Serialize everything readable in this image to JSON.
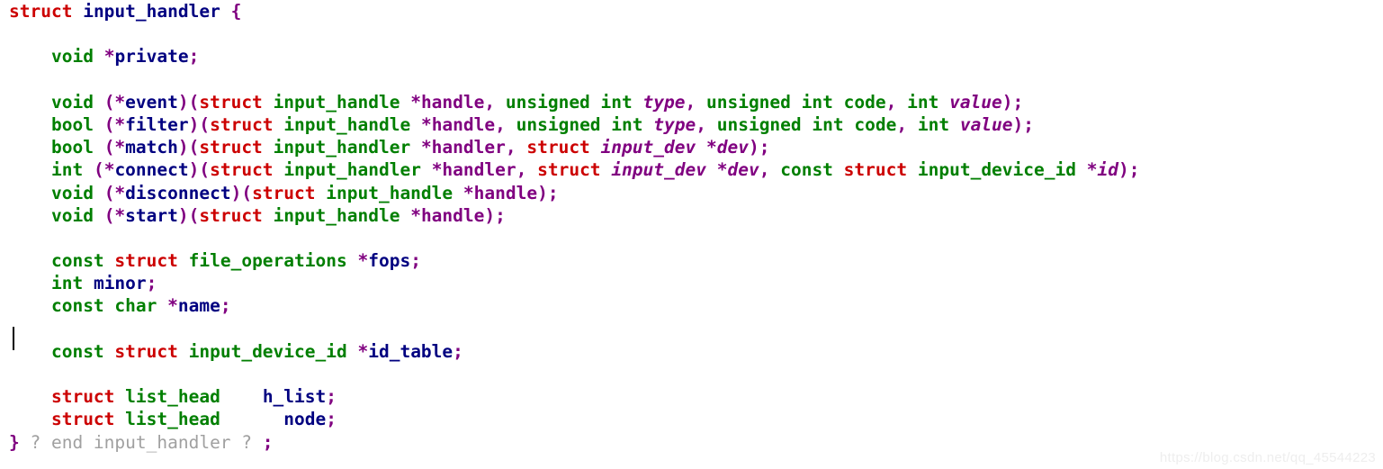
{
  "editor": {
    "language": "c",
    "background_color": "#ffffff",
    "caret_visible": true,
    "watermark": "https://blog.csdn.net/qq_45544223",
    "colors": {
      "keyword_struct": "#cc0000",
      "type": "#007f00",
      "identifier": "#000080",
      "punctuation": "#800080",
      "parameter": "#800080",
      "fold_marker": "#a0a0a0",
      "watermark": "#eeeeee"
    }
  },
  "code": {
    "lines": [
      {
        "index": 0,
        "text": "struct input_handler {",
        "tokens": [
          {
            "t": "struct",
            "c": "keyword"
          },
          {
            "t": " ",
            "c": "plain"
          },
          {
            "t": "input_handler",
            "c": "ident"
          },
          {
            "t": " ",
            "c": "plain"
          },
          {
            "t": "{",
            "c": "punct"
          }
        ]
      },
      {
        "index": 1,
        "text": "",
        "tokens": []
      },
      {
        "index": 2,
        "text": "    void *private;",
        "tokens": [
          {
            "t": "    ",
            "c": "plain"
          },
          {
            "t": "void",
            "c": "type"
          },
          {
            "t": " ",
            "c": "plain"
          },
          {
            "t": "*",
            "c": "punct"
          },
          {
            "t": "private",
            "c": "ident"
          },
          {
            "t": ";",
            "c": "punct"
          }
        ]
      },
      {
        "index": 3,
        "text": "",
        "tokens": []
      },
      {
        "index": 4,
        "text": "    void (*event)(struct input_handle *handle, unsigned int type, unsigned int code, int value);",
        "tokens": [
          {
            "t": "    ",
            "c": "plain"
          },
          {
            "t": "void",
            "c": "type"
          },
          {
            "t": " ",
            "c": "plain"
          },
          {
            "t": "(*",
            "c": "punct"
          },
          {
            "t": "event",
            "c": "ident"
          },
          {
            "t": ")(",
            "c": "punct"
          },
          {
            "t": "struct",
            "c": "keyword"
          },
          {
            "t": " ",
            "c": "plain"
          },
          {
            "t": "input_handle",
            "c": "type"
          },
          {
            "t": " ",
            "c": "plain"
          },
          {
            "t": "*handle,",
            "c": "punct"
          },
          {
            "t": " ",
            "c": "plain"
          },
          {
            "t": "unsigned int",
            "c": "type"
          },
          {
            "t": " ",
            "c": "plain"
          },
          {
            "t": "type",
            "c": "param"
          },
          {
            "t": ",",
            "c": "punct"
          },
          {
            "t": " ",
            "c": "plain"
          },
          {
            "t": "unsigned int",
            "c": "type"
          },
          {
            "t": " ",
            "c": "plain"
          },
          {
            "t": "code",
            "c": "type"
          },
          {
            "t": ",",
            "c": "punct"
          },
          {
            "t": " ",
            "c": "plain"
          },
          {
            "t": "int",
            "c": "type"
          },
          {
            "t": " ",
            "c": "plain"
          },
          {
            "t": "value",
            "c": "param"
          },
          {
            "t": ");",
            "c": "punct"
          }
        ]
      },
      {
        "index": 5,
        "text": "    bool (*filter)(struct input_handle *handle, unsigned int type, unsigned int code, int value);",
        "tokens": [
          {
            "t": "    ",
            "c": "plain"
          },
          {
            "t": "bool",
            "c": "type"
          },
          {
            "t": " ",
            "c": "plain"
          },
          {
            "t": "(*",
            "c": "punct"
          },
          {
            "t": "filter",
            "c": "ident"
          },
          {
            "t": ")(",
            "c": "punct"
          },
          {
            "t": "struct",
            "c": "keyword"
          },
          {
            "t": " ",
            "c": "plain"
          },
          {
            "t": "input_handle",
            "c": "type"
          },
          {
            "t": " ",
            "c": "plain"
          },
          {
            "t": "*handle,",
            "c": "punct"
          },
          {
            "t": " ",
            "c": "plain"
          },
          {
            "t": "unsigned int",
            "c": "type"
          },
          {
            "t": " ",
            "c": "plain"
          },
          {
            "t": "type",
            "c": "param"
          },
          {
            "t": ",",
            "c": "punct"
          },
          {
            "t": " ",
            "c": "plain"
          },
          {
            "t": "unsigned int",
            "c": "type"
          },
          {
            "t": " ",
            "c": "plain"
          },
          {
            "t": "code",
            "c": "type"
          },
          {
            "t": ",",
            "c": "punct"
          },
          {
            "t": " ",
            "c": "plain"
          },
          {
            "t": "int",
            "c": "type"
          },
          {
            "t": " ",
            "c": "plain"
          },
          {
            "t": "value",
            "c": "param"
          },
          {
            "t": ");",
            "c": "punct"
          }
        ]
      },
      {
        "index": 6,
        "text": "    bool (*match)(struct input_handler *handler, struct input_dev *dev);",
        "tokens": [
          {
            "t": "    ",
            "c": "plain"
          },
          {
            "t": "bool",
            "c": "type"
          },
          {
            "t": " ",
            "c": "plain"
          },
          {
            "t": "(*",
            "c": "punct"
          },
          {
            "t": "match",
            "c": "ident"
          },
          {
            "t": ")(",
            "c": "punct"
          },
          {
            "t": "struct",
            "c": "keyword"
          },
          {
            "t": " ",
            "c": "plain"
          },
          {
            "t": "input_handler",
            "c": "type"
          },
          {
            "t": " ",
            "c": "plain"
          },
          {
            "t": "*handler,",
            "c": "punct"
          },
          {
            "t": " ",
            "c": "plain"
          },
          {
            "t": "struct",
            "c": "keyword"
          },
          {
            "t": " ",
            "c": "plain"
          },
          {
            "t": "input_dev",
            "c": "param"
          },
          {
            "t": " ",
            "c": "plain"
          },
          {
            "t": "*",
            "c": "punct"
          },
          {
            "t": "dev",
            "c": "param"
          },
          {
            "t": ");",
            "c": "punct"
          }
        ]
      },
      {
        "index": 7,
        "text": "    int (*connect)(struct input_handler *handler, struct input_dev *dev, const struct input_device_id *id);",
        "tokens": [
          {
            "t": "    ",
            "c": "plain"
          },
          {
            "t": "int",
            "c": "type"
          },
          {
            "t": " ",
            "c": "plain"
          },
          {
            "t": "(*",
            "c": "punct"
          },
          {
            "t": "connect",
            "c": "ident"
          },
          {
            "t": ")(",
            "c": "punct"
          },
          {
            "t": "struct",
            "c": "keyword"
          },
          {
            "t": " ",
            "c": "plain"
          },
          {
            "t": "input_handler",
            "c": "type"
          },
          {
            "t": " ",
            "c": "plain"
          },
          {
            "t": "*handler,",
            "c": "punct"
          },
          {
            "t": " ",
            "c": "plain"
          },
          {
            "t": "struct",
            "c": "keyword"
          },
          {
            "t": " ",
            "c": "plain"
          },
          {
            "t": "input_dev",
            "c": "param"
          },
          {
            "t": " ",
            "c": "plain"
          },
          {
            "t": "*",
            "c": "punct"
          },
          {
            "t": "dev",
            "c": "param"
          },
          {
            "t": ",",
            "c": "punct"
          },
          {
            "t": " ",
            "c": "plain"
          },
          {
            "t": "const",
            "c": "type"
          },
          {
            "t": " ",
            "c": "plain"
          },
          {
            "t": "struct",
            "c": "keyword"
          },
          {
            "t": " ",
            "c": "plain"
          },
          {
            "t": "input_device_id",
            "c": "type"
          },
          {
            "t": " ",
            "c": "plain"
          },
          {
            "t": "*",
            "c": "punct"
          },
          {
            "t": "id",
            "c": "param"
          },
          {
            "t": ");",
            "c": "punct"
          }
        ]
      },
      {
        "index": 8,
        "text": "    void (*disconnect)(struct input_handle *handle);",
        "tokens": [
          {
            "t": "    ",
            "c": "plain"
          },
          {
            "t": "void",
            "c": "type"
          },
          {
            "t": " ",
            "c": "plain"
          },
          {
            "t": "(*",
            "c": "punct"
          },
          {
            "t": "disconnect",
            "c": "ident"
          },
          {
            "t": ")(",
            "c": "punct"
          },
          {
            "t": "struct",
            "c": "keyword"
          },
          {
            "t": " ",
            "c": "plain"
          },
          {
            "t": "input_handle",
            "c": "type"
          },
          {
            "t": " ",
            "c": "plain"
          },
          {
            "t": "*handle",
            "c": "punct"
          },
          {
            "t": ");",
            "c": "punct"
          }
        ]
      },
      {
        "index": 9,
        "text": "    void (*start)(struct input_handle *handle);",
        "tokens": [
          {
            "t": "    ",
            "c": "plain"
          },
          {
            "t": "void",
            "c": "type"
          },
          {
            "t": " ",
            "c": "plain"
          },
          {
            "t": "(*",
            "c": "punct"
          },
          {
            "t": "start",
            "c": "ident"
          },
          {
            "t": ")(",
            "c": "punct"
          },
          {
            "t": "struct",
            "c": "keyword"
          },
          {
            "t": " ",
            "c": "plain"
          },
          {
            "t": "input_handle",
            "c": "type"
          },
          {
            "t": " ",
            "c": "plain"
          },
          {
            "t": "*handle",
            "c": "punct"
          },
          {
            "t": ");",
            "c": "punct"
          }
        ]
      },
      {
        "index": 10,
        "text": "",
        "tokens": []
      },
      {
        "index": 11,
        "text": "    const struct file_operations *fops;",
        "tokens": [
          {
            "t": "    ",
            "c": "plain"
          },
          {
            "t": "const",
            "c": "type"
          },
          {
            "t": " ",
            "c": "plain"
          },
          {
            "t": "struct",
            "c": "keyword"
          },
          {
            "t": " ",
            "c": "plain"
          },
          {
            "t": "file_operations",
            "c": "type"
          },
          {
            "t": " ",
            "c": "plain"
          },
          {
            "t": "*",
            "c": "punct"
          },
          {
            "t": "fops",
            "c": "ident"
          },
          {
            "t": ";",
            "c": "punct"
          }
        ]
      },
      {
        "index": 12,
        "text": "    int minor;",
        "tokens": [
          {
            "t": "    ",
            "c": "plain"
          },
          {
            "t": "int",
            "c": "type"
          },
          {
            "t": " ",
            "c": "plain"
          },
          {
            "t": "minor",
            "c": "ident"
          },
          {
            "t": ";",
            "c": "punct"
          }
        ]
      },
      {
        "index": 13,
        "text": "    const char *name;",
        "tokens": [
          {
            "t": "    ",
            "c": "plain"
          },
          {
            "t": "const",
            "c": "type"
          },
          {
            "t": " ",
            "c": "plain"
          },
          {
            "t": "char",
            "c": "type"
          },
          {
            "t": " ",
            "c": "plain"
          },
          {
            "t": "*",
            "c": "punct"
          },
          {
            "t": "name",
            "c": "ident"
          },
          {
            "t": ";",
            "c": "punct"
          }
        ]
      },
      {
        "index": 14,
        "text": "",
        "tokens": []
      },
      {
        "index": 15,
        "text": "    const struct input_device_id *id_table;",
        "tokens": [
          {
            "t": "    ",
            "c": "plain"
          },
          {
            "t": "const",
            "c": "type"
          },
          {
            "t": " ",
            "c": "plain"
          },
          {
            "t": "struct",
            "c": "keyword"
          },
          {
            "t": " ",
            "c": "plain"
          },
          {
            "t": "input_device_id",
            "c": "type"
          },
          {
            "t": " ",
            "c": "plain"
          },
          {
            "t": "*",
            "c": "punct"
          },
          {
            "t": "id_table",
            "c": "ident"
          },
          {
            "t": ";",
            "c": "punct"
          }
        ]
      },
      {
        "index": 16,
        "text": "",
        "tokens": []
      },
      {
        "index": 17,
        "text": "    struct list_head    h_list;",
        "tokens": [
          {
            "t": "    ",
            "c": "plain"
          },
          {
            "t": "struct",
            "c": "keyword"
          },
          {
            "t": " ",
            "c": "plain"
          },
          {
            "t": "list_head",
            "c": "type"
          },
          {
            "t": "    ",
            "c": "plain"
          },
          {
            "t": "h_list",
            "c": "ident"
          },
          {
            "t": ";",
            "c": "punct"
          }
        ]
      },
      {
        "index": 18,
        "text": "    struct list_head    node;",
        "tokens": [
          {
            "t": "    ",
            "c": "plain"
          },
          {
            "t": "struct",
            "c": "keyword"
          },
          {
            "t": " ",
            "c": "plain"
          },
          {
            "t": "list_head",
            "c": "type"
          },
          {
            "t": "      ",
            "c": "plain"
          },
          {
            "t": "node",
            "c": "ident"
          },
          {
            "t": ";",
            "c": "punct"
          }
        ]
      },
      {
        "index": 19,
        "text": "} ? end input_handler ? ;",
        "tokens": [
          {
            "t": "}",
            "c": "punct"
          },
          {
            "t": " ? end input_handler ? ",
            "c": "fold"
          },
          {
            "t": ";",
            "c": "punct"
          }
        ]
      }
    ]
  }
}
